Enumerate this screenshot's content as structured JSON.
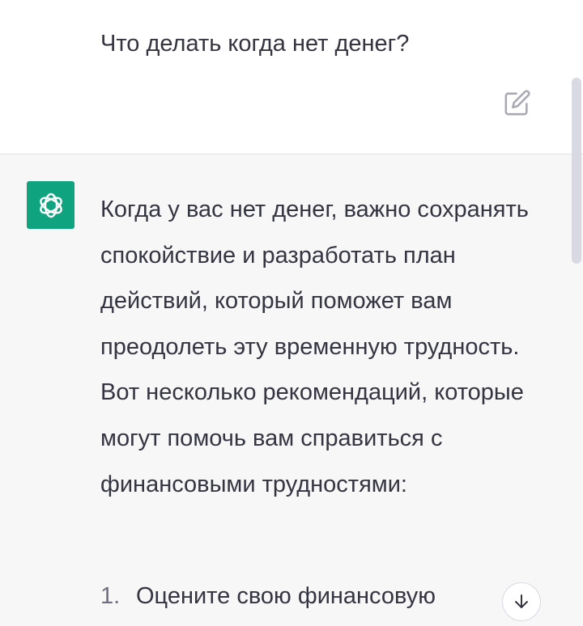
{
  "user_message": {
    "text": "Что делать когда нет денег?"
  },
  "assistant_message": {
    "paragraph": "Когда у вас нет денег, важно сохранять спокойствие и разработать план действий, который поможет вам преодолеть эту временную трудность. Вот несколько рекомендаций, которые могут помочь вам справиться с финансовыми трудностями:",
    "list": [
      {
        "number": "1.",
        "text": "Оцените свою финансовую"
      }
    ]
  },
  "icons": {
    "edit": "edit-icon",
    "avatar": "chatgpt-logo-icon",
    "scroll_down": "arrow-down-icon"
  },
  "colors": {
    "accent": "#10a37f",
    "assistant_bg": "#f7f7f8",
    "text": "#343541"
  }
}
